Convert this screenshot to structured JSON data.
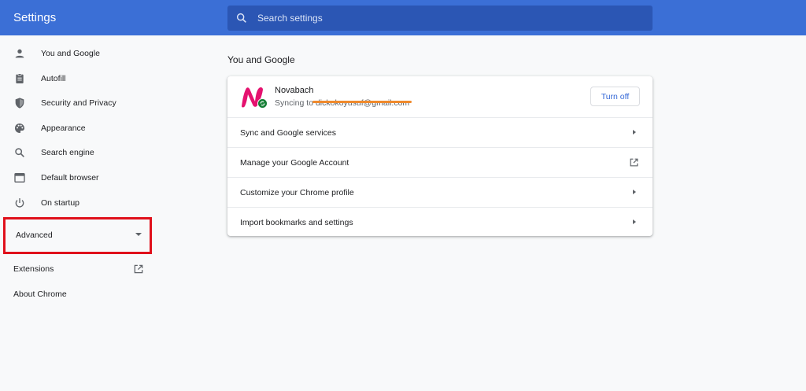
{
  "header": {
    "title": "Settings",
    "search_placeholder": "Search settings"
  },
  "sidebar": {
    "items": [
      {
        "label": "You and Google",
        "icon": "person-icon"
      },
      {
        "label": "Autofill",
        "icon": "clipboard-icon"
      },
      {
        "label": "Security and Privacy",
        "icon": "shield-icon"
      },
      {
        "label": "Appearance",
        "icon": "palette-icon"
      },
      {
        "label": "Search engine",
        "icon": "search-icon"
      },
      {
        "label": "Default browser",
        "icon": "browser-window-icon"
      },
      {
        "label": "On startup",
        "icon": "power-icon"
      }
    ],
    "advanced_label": "Advanced",
    "extensions_label": "Extensions",
    "about_label": "About Chrome"
  },
  "main": {
    "section_title": "You and Google",
    "profile": {
      "name": "Novabach",
      "sync_prefix": "Syncing to ",
      "email": "dickokoyusuf@gmail.com",
      "turn_off_label": "Turn off"
    },
    "rows": [
      {
        "label": "Sync and Google services",
        "trailing": "arrow-right-icon"
      },
      {
        "label": "Manage your Google Account",
        "trailing": "open-in-new-icon"
      },
      {
        "label": "Customize your Chrome profile",
        "trailing": "arrow-right-icon"
      },
      {
        "label": "Import bookmarks and settings",
        "trailing": "arrow-right-icon"
      }
    ]
  },
  "colors": {
    "header": "#3b6fd6",
    "accent": "#3367d6",
    "highlight_box": "#e0101b",
    "avatar": "#e5126f",
    "sync_badge": "#188038"
  }
}
